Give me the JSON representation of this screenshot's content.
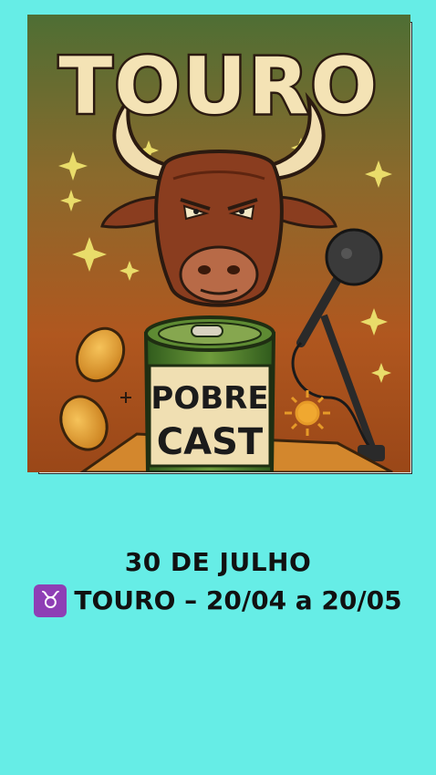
{
  "cover": {
    "title": "TOURO",
    "can_line1": "POBRE",
    "can_line2": "CAST"
  },
  "caption": {
    "date": "30 DE JULHO",
    "sign_icon": "♉",
    "sign_text": "TOURO – 20/04 a 20/05"
  },
  "colors": {
    "background": "#66ede6",
    "title_fill": "#f4e3b5",
    "bull": "#8a3d1f",
    "can": "#4f7d2c",
    "coin": "#e2a235"
  }
}
